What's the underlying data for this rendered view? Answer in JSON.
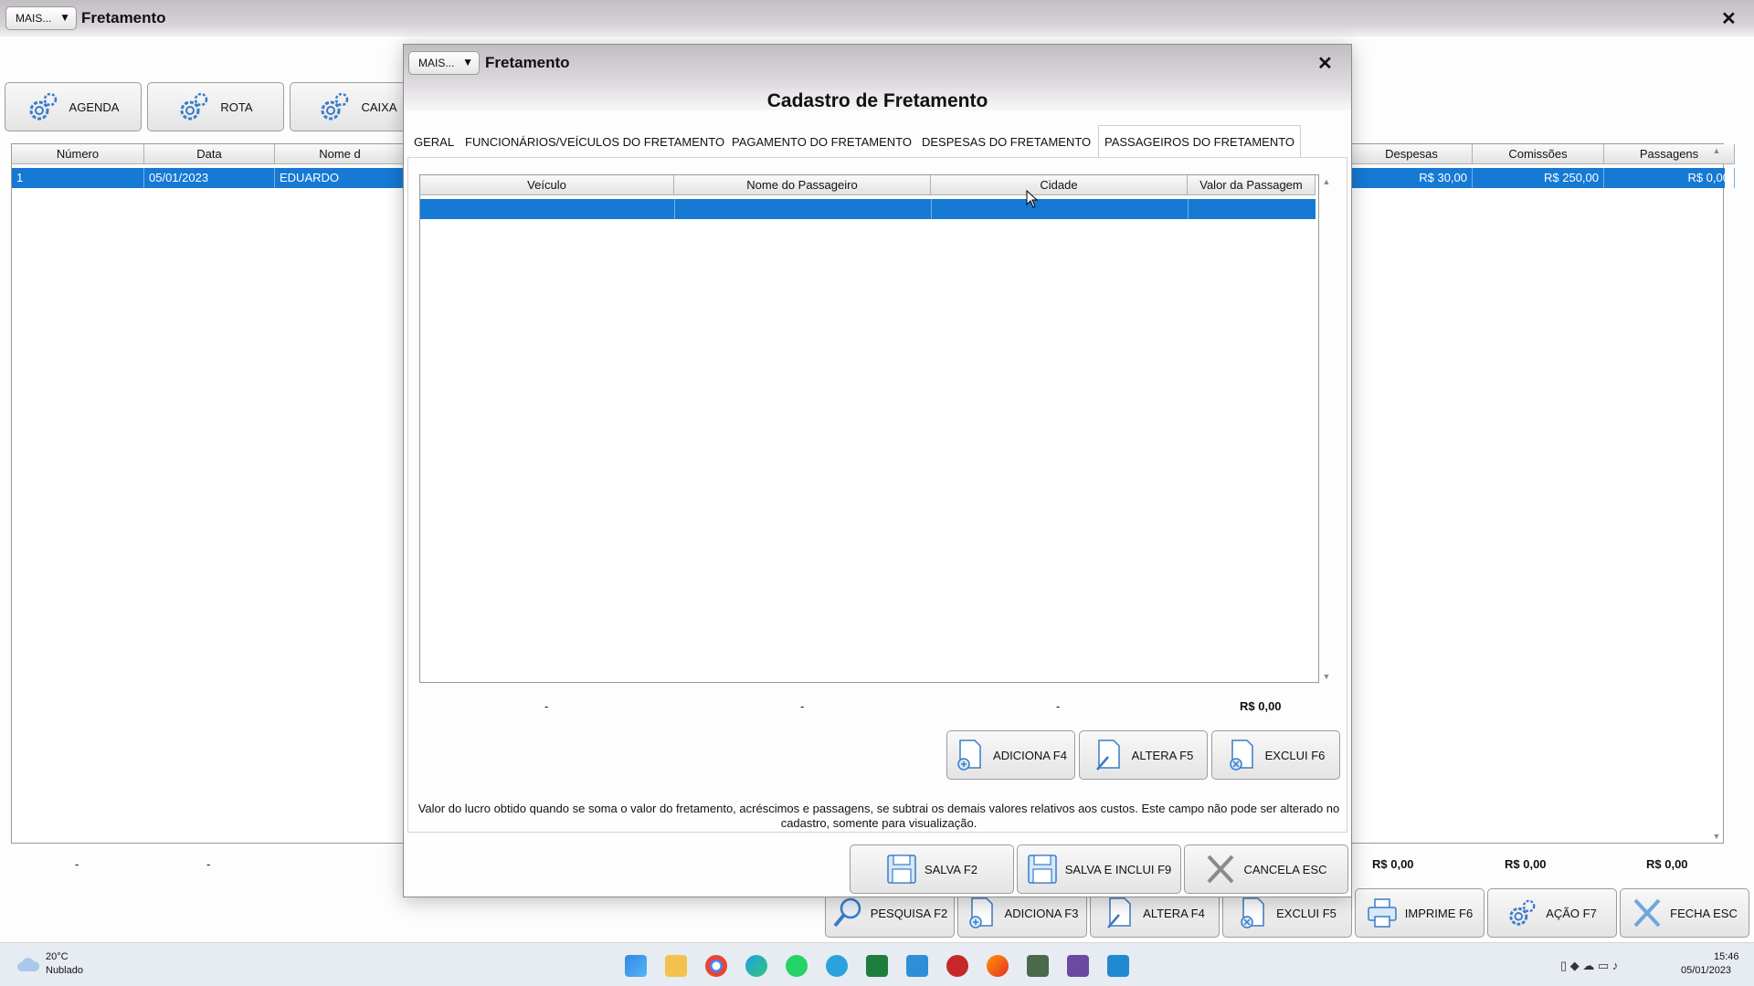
{
  "main": {
    "mais_label": "MAIS...",
    "title": "Fretamento",
    "close": "✕",
    "toolbar": [
      "AGENDA",
      "ROTA",
      "CAIXA"
    ],
    "headers": [
      "Número",
      "Data",
      "Nome d",
      "Despesas",
      "Comissões",
      "Passagens"
    ],
    "row": {
      "numero": "1",
      "data": "05/01/2023",
      "nome": "EDUARDO",
      "despesas": "R$ 30,00",
      "comissoes": "R$ 250,00",
      "passagens": "R$ 0,00"
    },
    "footer": {
      "numero": "-",
      "data": "-",
      "despesas": "R$ 0,00",
      "comissoes": "R$ 0,00",
      "passagens": "R$ 0,00"
    },
    "bottom_buttons": [
      "PESQUISA F2",
      "ADICIONA F3",
      "ALTERA F4",
      "EXCLUI F5",
      "IMPRIME F6",
      "AÇÃO F7",
      "FECHA ESC"
    ]
  },
  "modal": {
    "mais_label": "MAIS...",
    "title": "Fretamento",
    "close": "✕",
    "heading": "Cadastro de Fretamento",
    "tabs": [
      "GERAL",
      "FUNCIONÁRIOS/VEÍCULOS DO FRETAMENTO",
      "PAGAMENTO DO FRETAMENTO",
      "DESPESAS DO FRETAMENTO",
      "PASSAGEIROS DO FRETAMENTO"
    ],
    "active_tab": "PASSAGEIROS DO FRETAMENTO",
    "grid_headers": [
      "Veículo",
      "Nome do Passageiro",
      "Cidade",
      "Valor da Passagem"
    ],
    "summary": [
      "-",
      "-",
      "-",
      "R$ 0,00"
    ],
    "grid_buttons": [
      "ADICIONA F4",
      "ALTERA F5",
      "EXCLUI F6"
    ],
    "note": "Valor do lucro obtido quando se soma o valor do fretamento, acréscimos e passagens, se subtrai os demais valores relativos aos custos. Este campo não pode ser alterado no cadastro, somente para visualização.",
    "action_buttons": [
      "SALVA F2",
      "SALVA E INCLUI F9",
      "CANCELA ESC"
    ]
  },
  "taskbar": {
    "temp": "20°C",
    "weather": "Nublado",
    "time": "15:46",
    "date": "05/01/2023"
  },
  "colors": {
    "selection": "#1679d4",
    "title_gradient": "#c3bdc4"
  }
}
